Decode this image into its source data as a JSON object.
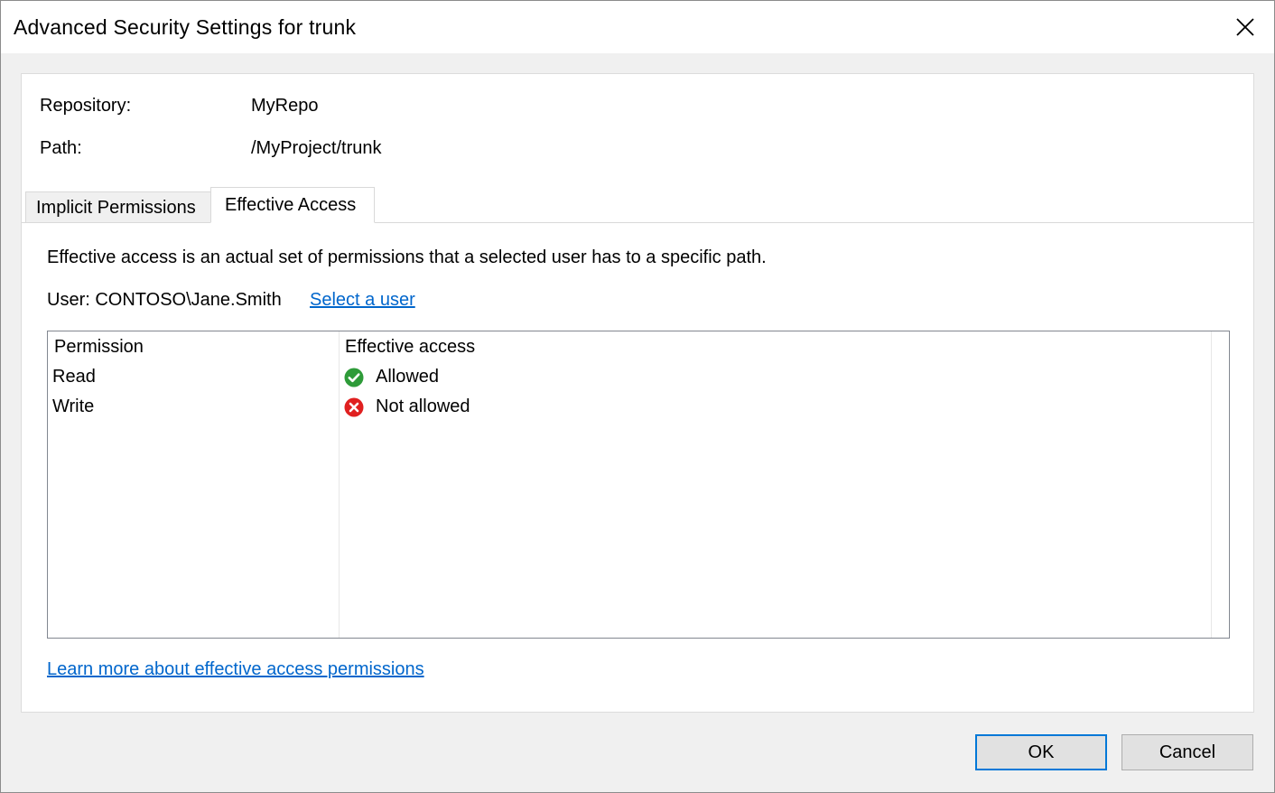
{
  "window": {
    "title": "Advanced Security Settings for trunk"
  },
  "info": {
    "repository_label": "Repository:",
    "repository_value": "MyRepo",
    "path_label": "Path:",
    "path_value": "/MyProject/trunk"
  },
  "tabs": [
    {
      "label": "Implicit Permissions",
      "selected": false
    },
    {
      "label": "Effective Access",
      "selected": true
    }
  ],
  "effective_access": {
    "description": "Effective access is an actual set of permissions that a selected user has to a specific path.",
    "user_text": "User: CONTOSO\\Jane.Smith",
    "select_user_link": "Select a user",
    "columns": [
      "Permission",
      "Effective access"
    ],
    "rows": [
      {
        "permission": "Read",
        "access": "Allowed",
        "status_icon": "check-circle-icon",
        "status_color": "#2e9b39"
      },
      {
        "permission": "Write",
        "access": "Not allowed",
        "status_icon": "x-circle-icon",
        "status_color": "#e02020"
      }
    ],
    "learn_more_link": "Learn more about effective access permissions"
  },
  "buttons": {
    "ok": "OK",
    "cancel": "Cancel"
  },
  "colors": {
    "link": "#0066cc",
    "focus_border": "#0078d7"
  }
}
